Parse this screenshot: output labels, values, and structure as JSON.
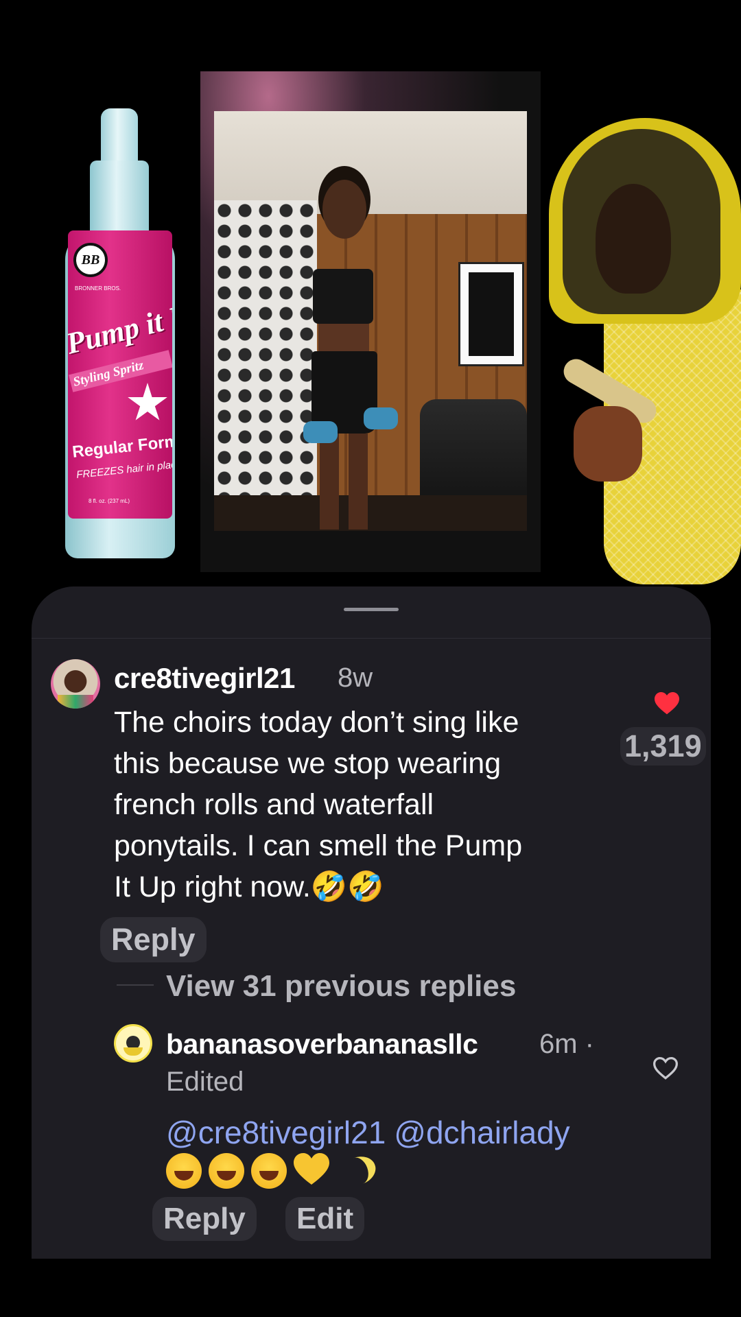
{
  "collage": {
    "bottle": {
      "logo": "BB",
      "brand": "BRONNER BROS.",
      "title": "Pump it Up!",
      "subtitle": "Styling Spritz",
      "formula": "Regular Formula",
      "tagline": "FREEZES hair in place",
      "size": "8 fl. oz. (237 mL)"
    }
  },
  "sheet": {
    "comment": {
      "username": "cre8tivegirl21",
      "time": "8w",
      "text": "The choirs today don’t sing like this because we stop wearing french rolls and waterfall ponytails. I can smell the Pump It Up right now.🤣🤣",
      "like_count": "1,319",
      "liked": true,
      "reply_label": "Reply"
    },
    "thread": {
      "view_replies": "View 31 previous replies"
    },
    "reply": {
      "username": "bananasoverbananasllc",
      "time": "6m ·",
      "edited": "Edited",
      "mention_1": "@cre8tivegirl21",
      "mention_2": "@dchairlady",
      "emojis": [
        "😂",
        "😂",
        "😂",
        "💛",
        "🍌"
      ],
      "reply_label": "Reply",
      "edit_label": "Edit"
    },
    "colors": {
      "sheet_bg": "#1e1d23",
      "mention": "#8fa5f0",
      "like_red": "#ff3040"
    }
  }
}
